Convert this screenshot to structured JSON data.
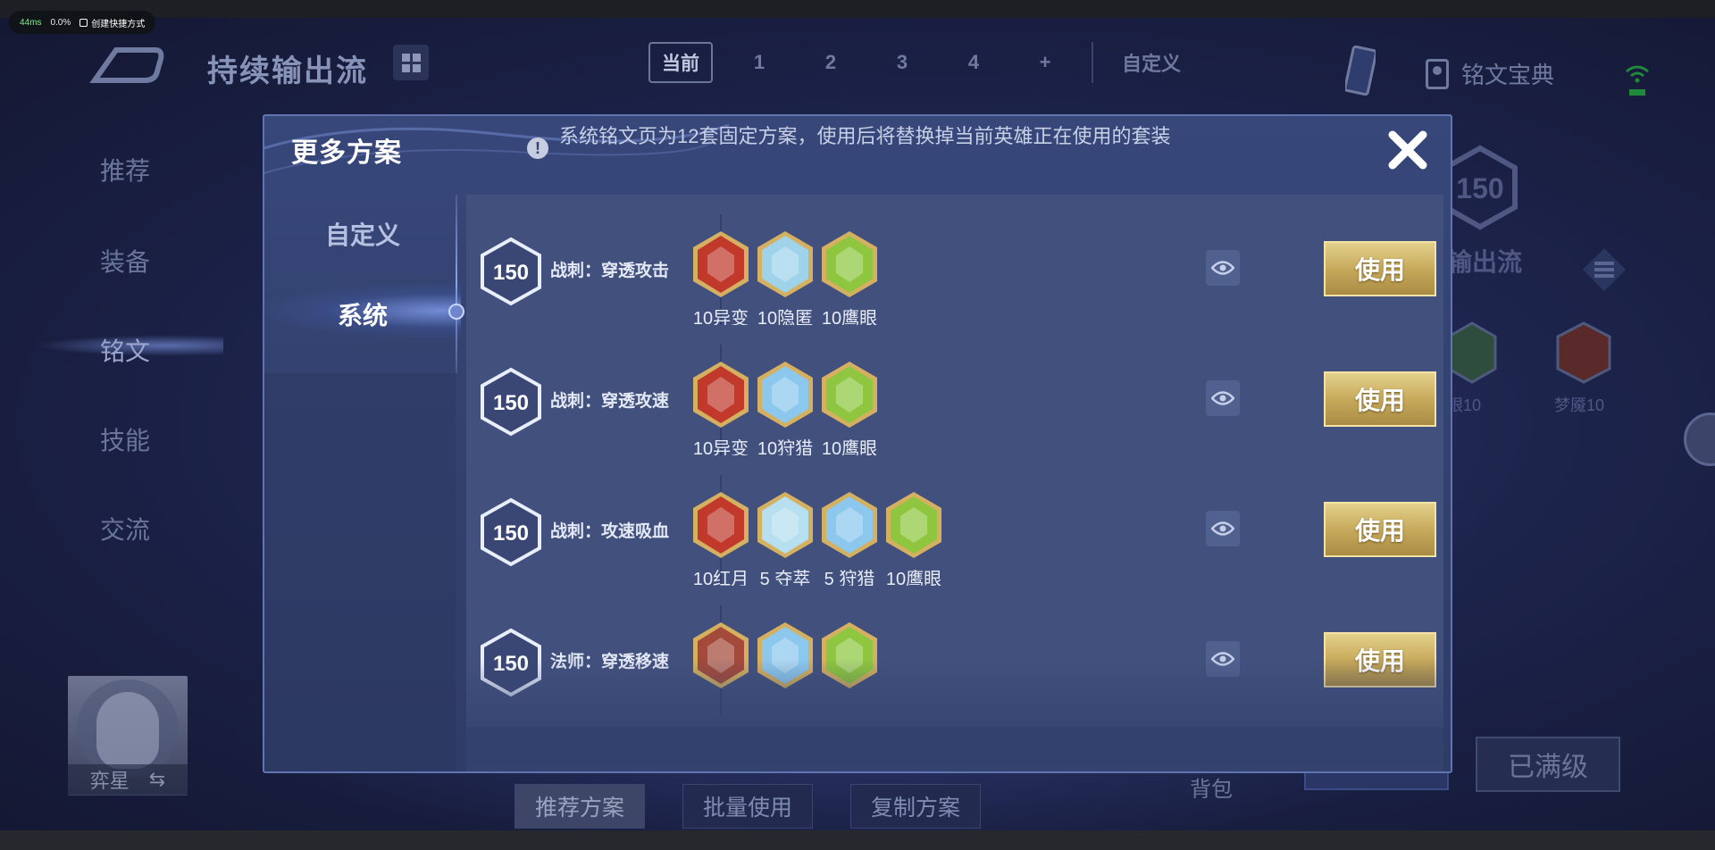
{
  "perf": {
    "ms": "44ms",
    "pct": "0.0%",
    "shortcut": "创建快捷方式"
  },
  "header": {
    "title": "持续输出流",
    "tabs": [
      {
        "label": "当前"
      },
      {
        "label": "1"
      },
      {
        "label": "2"
      },
      {
        "label": "3"
      },
      {
        "label": "4"
      },
      {
        "label": "+"
      },
      {
        "label": "自定义"
      }
    ],
    "codex_label": "铭文宝典"
  },
  "left_nav": {
    "items": [
      "推荐",
      "装备",
      "铭文",
      "技能",
      "交流"
    ]
  },
  "hero": {
    "name": "弈星"
  },
  "bottom": {
    "buttons": [
      "推荐方案",
      "批量使用",
      "复制方案"
    ],
    "bag": "背包",
    "maxed": "已满级"
  },
  "right_peek": {
    "level": "150",
    "title": "输出流",
    "label_1": "眼10",
    "label_2": "梦魇10"
  },
  "modal": {
    "title": "更多方案",
    "notice": "系统铭文页为12套固定方案，使用后将替换掉当前英雄正在使用的套装",
    "tabs": [
      "自定义",
      "系统"
    ],
    "use_label": "使用",
    "rows": [
      {
        "level": "150",
        "name": "战刺：穿透攻击",
        "gems": [
          {
            "label": "10异变",
            "color": "#c0392b"
          },
          {
            "label": "10隐匿",
            "color": "#9fd3ea"
          },
          {
            "label": "10鹰眼",
            "color": "#8ec63f"
          }
        ]
      },
      {
        "level": "150",
        "name": "战刺：穿透攻速",
        "gems": [
          {
            "label": "10异变",
            "color": "#c0392b"
          },
          {
            "label": "10狩猎",
            "color": "#8cc8ee"
          },
          {
            "label": "10鹰眼",
            "color": "#8ec63f"
          }
        ]
      },
      {
        "level": "150",
        "name": "战刺：攻速吸血",
        "gems": [
          {
            "label": "10红月",
            "color": "#c0392b"
          },
          {
            "label": "5 夺萃",
            "color": "#b6dff0"
          },
          {
            "label": "5 狩猎",
            "color": "#8cc8ee"
          },
          {
            "label": "10鹰眼",
            "color": "#8ec63f"
          }
        ]
      },
      {
        "level": "150",
        "name": "法师：穿透移速",
        "gems": [
          {
            "label": "",
            "color": "#a34a3a"
          },
          {
            "label": "",
            "color": "#8cc8ee"
          },
          {
            "label": "",
            "color": "#8ec63f"
          }
        ]
      }
    ]
  }
}
